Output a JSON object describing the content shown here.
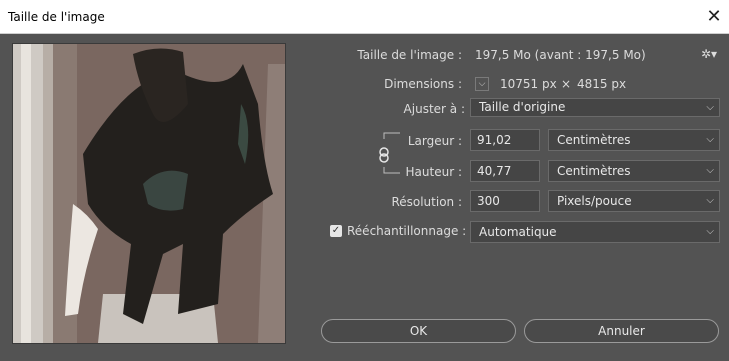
{
  "window": {
    "title": "Taille de l'image",
    "close_icon": "close-icon"
  },
  "info": {
    "size_label": "Taille de l'image :",
    "size_value": "197,5 Mo (avant : 197,5 Mo)",
    "gear_icon": "gear-icon",
    "dimensions_label": "Dimensions :",
    "dimensions_width": "10751 px",
    "dimensions_times": "×",
    "dimensions_height": "4815 px"
  },
  "fit": {
    "label": "Ajuster à :",
    "value": "Taille d'origine"
  },
  "width": {
    "label": "Largeur :",
    "value": "91,02",
    "unit": "Centimètres"
  },
  "height": {
    "label": "Hauteur :",
    "value": "40,77",
    "unit": "Centimètres"
  },
  "resolution": {
    "label": "Résolution :",
    "value": "300",
    "unit": "Pixels/pouce"
  },
  "resample": {
    "label": "Rééchantillonnage :",
    "checked": true,
    "value": "Automatique"
  },
  "buttons": {
    "ok": "OK",
    "cancel": "Annuler"
  },
  "icons": {
    "link": "chain-link-icon",
    "chevron": "chevron-down-icon",
    "checkmark": "checkmark-icon"
  }
}
